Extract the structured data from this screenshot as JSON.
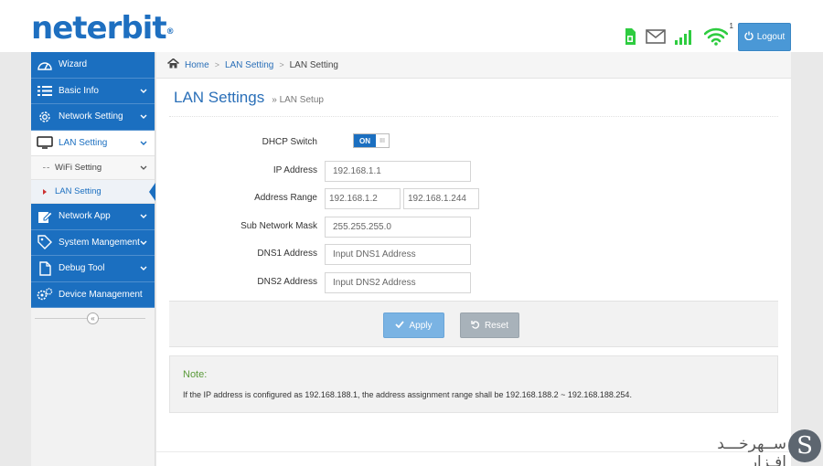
{
  "header": {
    "logo_text": "neterbit",
    "logo_mark": "®",
    "wifi_count": "1",
    "logout_label": "Logout",
    "icons": [
      "sim-icon",
      "mail-icon",
      "signal-icon",
      "wifi-icon",
      "power-icon"
    ]
  },
  "sidebar": {
    "items": [
      {
        "label": "Wizard",
        "icon": "dashboard-icon"
      },
      {
        "label": "Basic Info",
        "icon": "list-icon"
      },
      {
        "label": "Network Setting",
        "icon": "network-gear-icon"
      },
      {
        "label": "LAN Setting",
        "icon": "monitor-icon"
      },
      {
        "label": "WiFi Setting"
      },
      {
        "label": "LAN Setting"
      },
      {
        "label": "Network App",
        "icon": "edit-icon"
      },
      {
        "label": "System Mangement",
        "icon": "tag-icon"
      },
      {
        "label": "Debug Tool",
        "icon": "file-icon"
      },
      {
        "label": "Device Management",
        "icon": "gears-icon"
      }
    ],
    "collapse_glyph": "«"
  },
  "breadcrumb": [
    "Home",
    "LAN Setting",
    "LAN Setting"
  ],
  "page": {
    "title": "LAN Settings",
    "subtitle": "» LAN Setup"
  },
  "form": {
    "dhcp_label": "DHCP Switch",
    "dhcp_state": "ON",
    "dhcp_knob": "III",
    "ip_label": "IP Address",
    "ip_value": "192.168.1.1",
    "range_label": "Address Range",
    "range_start": "192.168.1.2",
    "range_end": "192.168.1.244",
    "mask_label": "Sub Network Mask",
    "mask_value": "255.255.255.0",
    "dns1_label": "DNS1 Address",
    "dns1_placeholder": "Input DNS1 Address",
    "dns2_label": "DNS2 Address",
    "dns2_placeholder": "Input DNS2 Address"
  },
  "actions": {
    "apply": "Apply",
    "reset": "Reset"
  },
  "note": {
    "heading": "Note:",
    "body": "If the IP address is configured as 192.168.188.1, the address assignment range shall be 192.168.188.2 ~ 192.168.188.254."
  },
  "watermark": {
    "text": "ســهرخـــد افـزار",
    "mark": "S"
  },
  "colors": {
    "brand": "#1b6fc0",
    "accent_green": "#2ecc40",
    "note_green": "#5a9a3a"
  }
}
